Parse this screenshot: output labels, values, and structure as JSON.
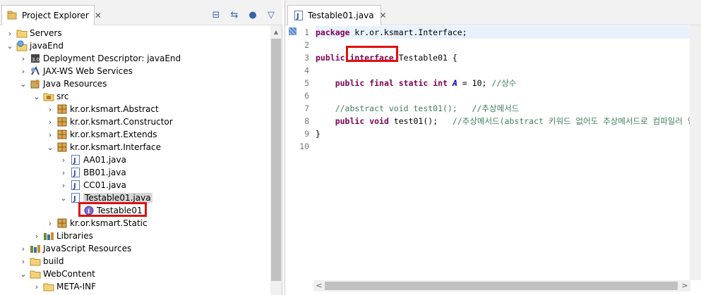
{
  "explorer": {
    "tab_title": "Project Explorer",
    "close_glyph": "✕",
    "toolbar": [
      {
        "name": "collapse-all-icon",
        "glyph": "⊟"
      },
      {
        "name": "link-with-editor-icon",
        "glyph": "⇆"
      },
      {
        "name": "focus-icon",
        "glyph": "●"
      },
      {
        "name": "view-menu-icon",
        "glyph": "▽"
      }
    ],
    "tree": [
      {
        "label": "Servers",
        "depth": 0,
        "chev": "›",
        "icon": "folder-icon"
      },
      {
        "label": "javaEnd",
        "depth": 0,
        "chev": "⌄",
        "icon": "web-project-icon"
      },
      {
        "label": "Deployment Descriptor: javaEnd",
        "depth": 1,
        "chev": "›",
        "icon": "deployment-descriptor-icon"
      },
      {
        "label": "JAX-WS Web Services",
        "depth": 1,
        "chev": "›",
        "icon": "web-services-icon"
      },
      {
        "label": "Java Resources",
        "depth": 1,
        "chev": "⌄",
        "icon": "java-resources-icon"
      },
      {
        "label": "src",
        "depth": 2,
        "chev": "⌄",
        "icon": "source-folder-icon"
      },
      {
        "label": "kr.or.ksmart.Abstract",
        "depth": 3,
        "chev": "›",
        "icon": "package-icon"
      },
      {
        "label": "kr.or.ksmart.Constructor",
        "depth": 3,
        "chev": "›",
        "icon": "package-icon"
      },
      {
        "label": "kr.or.ksmart.Extends",
        "depth": 3,
        "chev": "›",
        "icon": "package-icon"
      },
      {
        "label": "kr.or.ksmart.Interface",
        "depth": 3,
        "chev": "⌄",
        "icon": "package-icon"
      },
      {
        "label": "AA01.java",
        "depth": 4,
        "chev": "›",
        "icon": "java-file-icon"
      },
      {
        "label": "BB01.java",
        "depth": 4,
        "chev": "›",
        "icon": "java-file-icon"
      },
      {
        "label": "CC01.java",
        "depth": 4,
        "chev": "›",
        "icon": "java-file-icon"
      },
      {
        "label": "Testable01.java",
        "depth": 4,
        "chev": "⌄",
        "icon": "java-file-icon",
        "selected": true
      },
      {
        "label": "Testable01",
        "depth": 5,
        "chev": "",
        "icon": "interface-icon"
      },
      {
        "label": "kr.or.ksmart.Static",
        "depth": 3,
        "chev": "›",
        "icon": "package-icon"
      },
      {
        "label": "Libraries",
        "depth": 2,
        "chev": "›",
        "icon": "libraries-icon"
      },
      {
        "label": "JavaScript Resources",
        "depth": 1,
        "chev": "›",
        "icon": "javascript-resources-icon"
      },
      {
        "label": "build",
        "depth": 1,
        "chev": "›",
        "icon": "folder-icon"
      },
      {
        "label": "WebContent",
        "depth": 1,
        "chev": "⌄",
        "icon": "folder-icon"
      },
      {
        "label": "META-INF",
        "depth": 2,
        "chev": "›",
        "icon": "folder-icon"
      }
    ]
  },
  "editor": {
    "tab_title": "Testable01.java",
    "close_glyph": "✕",
    "line_numbers": [
      "1",
      "2",
      "3",
      "4",
      "5",
      "6",
      "7",
      "8",
      "9",
      "10"
    ],
    "lines": [
      [
        {
          "t": "package",
          "c": "kw"
        },
        {
          "t": " kr.or.ksmart.Interface;",
          "c": ""
        }
      ],
      [],
      [
        {
          "t": "public",
          "c": "kw"
        },
        {
          "t": " ",
          "c": ""
        },
        {
          "t": "interface",
          "c": "kw"
        },
        {
          "t": " Testable01 {",
          "c": ""
        }
      ],
      [],
      [
        {
          "t": "    ",
          "c": ""
        },
        {
          "t": "public",
          "c": "kw"
        },
        {
          "t": " ",
          "c": ""
        },
        {
          "t": "final",
          "c": "kw"
        },
        {
          "t": " ",
          "c": ""
        },
        {
          "t": "static",
          "c": "kw"
        },
        {
          "t": " ",
          "c": ""
        },
        {
          "t": "int",
          "c": "kw"
        },
        {
          "t": " ",
          "c": ""
        },
        {
          "t": "A",
          "c": "ital"
        },
        {
          "t": " = 10; ",
          "c": ""
        },
        {
          "t": "//상수",
          "c": "cm"
        }
      ],
      [],
      [
        {
          "t": "    ",
          "c": ""
        },
        {
          "t": "//abstract void test01();   //추상메서드",
          "c": "cm"
        }
      ],
      [
        {
          "t": "    ",
          "c": ""
        },
        {
          "t": "public",
          "c": "kw"
        },
        {
          "t": " ",
          "c": ""
        },
        {
          "t": "void",
          "c": "kw"
        },
        {
          "t": " test01();   ",
          "c": ""
        },
        {
          "t": "//추상메서드(abstract 키워드 없어도 추상메서드로 컴파일러 인식",
          "c": "cm"
        }
      ],
      [
        {
          "t": "}",
          "c": ""
        }
      ],
      []
    ],
    "scroll_left_glyph": "<",
    "scroll_right_glyph": ">"
  }
}
